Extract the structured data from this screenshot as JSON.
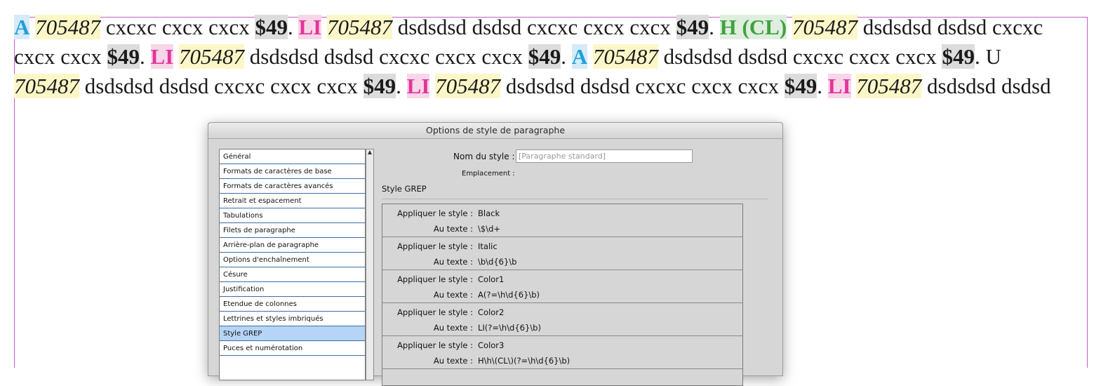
{
  "paragraph": {
    "runs": [
      {
        "t": "A",
        "s": "c1"
      },
      {
        "t": " ",
        "s": ""
      },
      {
        "t": "705487",
        "s": "it"
      },
      {
        "t": " cxcxc cxcx cxcx ",
        "s": ""
      },
      {
        "t": "$49",
        "s": "bk"
      },
      {
        "t": ". ",
        "s": ""
      },
      {
        "t": "LI",
        "s": "c2"
      },
      {
        "t": " ",
        "s": ""
      },
      {
        "t": "705487",
        "s": "it"
      },
      {
        "t": " dsdsdsd dsdsd cxcxc cxcx cxcx ",
        "s": ""
      },
      {
        "t": "$49",
        "s": "bk"
      },
      {
        "t": ". ",
        "s": ""
      },
      {
        "t": "H (CL)",
        "s": "c3"
      },
      {
        "t": " ",
        "s": ""
      },
      {
        "t": "705487",
        "s": "it"
      },
      {
        "t": " dsdsdsd dsdsd cxcxc cxcx cxcx ",
        "s": ""
      },
      {
        "t": "$49",
        "s": "bk"
      },
      {
        "t": ". ",
        "s": ""
      },
      {
        "t": "LI",
        "s": "c2"
      },
      {
        "t": " ",
        "s": ""
      },
      {
        "t": "705487",
        "s": "it"
      },
      {
        "t": " dsdsdsd dsdsd cxcxc cxcx cxcx ",
        "s": ""
      },
      {
        "t": "$49",
        "s": "bk"
      },
      {
        "t": ". ",
        "s": ""
      },
      {
        "t": "A",
        "s": "c1"
      },
      {
        "t": " ",
        "s": ""
      },
      {
        "t": "705487",
        "s": "it"
      },
      {
        "t": " dsdsdsd dsdsd cxcxc cxcx cxcx ",
        "s": ""
      },
      {
        "t": "$49",
        "s": "bk"
      },
      {
        "t": ". U ",
        "s": ""
      },
      {
        "t": "705487",
        "s": "it"
      },
      {
        "t": " dsdsdsd dsdsd cxcxc cxcx cxcx ",
        "s": ""
      },
      {
        "t": "$49",
        "s": "bk"
      },
      {
        "t": ". ",
        "s": ""
      },
      {
        "t": "LI",
        "s": "c2"
      },
      {
        "t": " ",
        "s": ""
      },
      {
        "t": "705487",
        "s": "it"
      },
      {
        "t": " dsdsdsd dsdsd cxcxc cxcx cxcx ",
        "s": ""
      },
      {
        "t": "$49",
        "s": "bk"
      },
      {
        "t": ". ",
        "s": ""
      },
      {
        "t": "LI",
        "s": "c2"
      },
      {
        "t": " ",
        "s": ""
      },
      {
        "t": "705487",
        "s": "it"
      },
      {
        "t": " dsdsdsd dsdsd",
        "s": ""
      }
    ]
  },
  "dialog": {
    "title": "Options de style de paragraphe",
    "style_name_label": "Nom du style :",
    "style_name_value": "[Paragraphe standard]",
    "location_label": "Emplacement :",
    "section_title": "Style GREP",
    "categories": [
      {
        "label": "Général",
        "selected": false
      },
      {
        "label": "Formats de caractères de base",
        "selected": false
      },
      {
        "label": "Formats de caractères avancés",
        "selected": false
      },
      {
        "label": "Retrait et espacement",
        "selected": false
      },
      {
        "label": "Tabulations",
        "selected": false
      },
      {
        "label": "Filets de paragraphe",
        "selected": false
      },
      {
        "label": "Arrière-plan de paragraphe",
        "selected": false
      },
      {
        "label": "Options d'enchaînement",
        "selected": false
      },
      {
        "label": "Césure",
        "selected": false
      },
      {
        "label": "Justification",
        "selected": false
      },
      {
        "label": "Etendue de colonnes",
        "selected": false
      },
      {
        "label": "Lettrines et styles imbriqués",
        "selected": false
      },
      {
        "label": "Style GREP",
        "selected": true
      },
      {
        "label": "Puces et numérotation",
        "selected": false
      }
    ],
    "apply_label": "Appliquer le style :",
    "text_label": "Au texte :",
    "rules": [
      {
        "style": "Black",
        "text": "\\$\\d+"
      },
      {
        "style": "Italic",
        "text": "\\b\\d{6}\\b"
      },
      {
        "style": "Color1",
        "text": "A(?=\\h\\d{6}\\b)"
      },
      {
        "style": "Color2",
        "text": "LI(?=\\h\\d{6}\\b)"
      },
      {
        "style": "Color3",
        "text": "H\\h\\(CL\\)(?=\\h\\d{6}\\b)"
      }
    ]
  }
}
